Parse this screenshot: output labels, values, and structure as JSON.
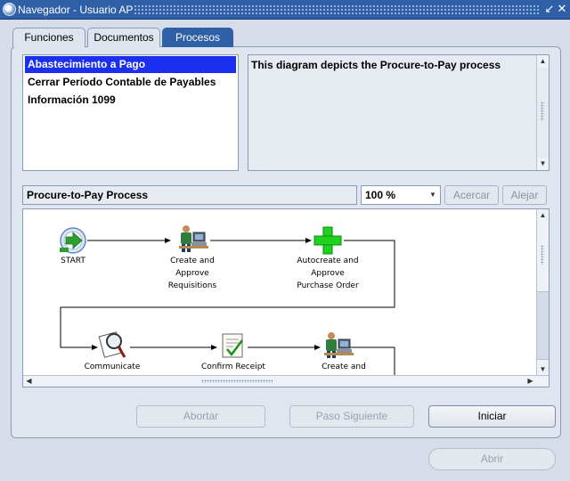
{
  "window": {
    "title": "Navegador - Usuario AP",
    "app_icon": "oracle-globe-icon",
    "controls": {
      "restore": "↙",
      "close": "✕"
    }
  },
  "tabs": [
    {
      "label": "Funciones",
      "active": false
    },
    {
      "label": "Documentos",
      "active": false
    },
    {
      "label": "Procesos",
      "active": true
    }
  ],
  "processes": {
    "items": [
      {
        "label": "Abastecimiento a Pago",
        "selected": true
      },
      {
        "label": "Cerrar Período Contable de Payables",
        "selected": false
      },
      {
        "label": "Información 1099",
        "selected": false
      }
    ]
  },
  "description": {
    "text": "This diagram depicts the Procure-to-Pay process"
  },
  "diagram_toolbar": {
    "title": "Procure-to-Pay Process",
    "zoom_value": "100 %",
    "zoom_in_label": "Acercar",
    "zoom_out_label": "Alejar"
  },
  "diagram": {
    "nodes": [
      {
        "id": "start",
        "icon": "start-arrow-icon",
        "lines": [
          "START"
        ]
      },
      {
        "id": "create-req",
        "icon": "person-at-computer-icon",
        "lines": [
          "Create and",
          "Approve",
          "Requisitions"
        ]
      },
      {
        "id": "autocreate-po",
        "icon": "green-plus-icon",
        "lines": [
          "Autocreate and",
          "Approve",
          "Purchase Order"
        ]
      },
      {
        "id": "communicate",
        "icon": "magnifier-document-icon",
        "lines": [
          "Communicate"
        ]
      },
      {
        "id": "confirm-receipt",
        "icon": "checklist-icon",
        "lines": [
          "Confirm Receipt"
        ]
      },
      {
        "id": "create-invoice",
        "icon": "person-at-computer-icon",
        "lines": [
          "Create and"
        ]
      }
    ]
  },
  "actions": {
    "abort_label": "Abortar",
    "next_step_label": "Paso Siguiente",
    "start_label": "Iniciar",
    "open_label": "Abrir"
  },
  "colors": {
    "title_bar": "#2f5fa6",
    "selection": "#1b2ff0",
    "active_tab": "#2f5fa6",
    "background": "#d6dde8"
  }
}
